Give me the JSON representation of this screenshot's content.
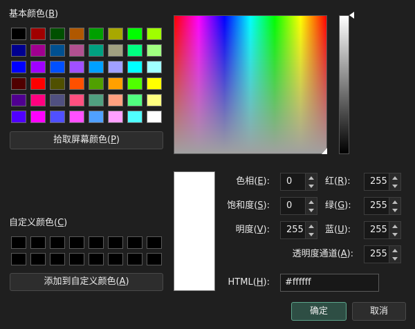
{
  "basic_colors": {
    "label": "基本颜色(",
    "label_key": "B",
    "label_tail": ")",
    "swatches": [
      "#000000",
      "#a00000",
      "#005000",
      "#b05800",
      "#00a000",
      "#a8a800",
      "#00ff00",
      "#a0ff00",
      "#000090",
      "#a00090",
      "#005090",
      "#b05090",
      "#00a080",
      "#a0a080",
      "#00ff80",
      "#a0ff80",
      "#0000ff",
      "#a000ff",
      "#0050ff",
      "#a050ff",
      "#00a0ff",
      "#a0a0ff",
      "#00ffff",
      "#a0ffff",
      "#500000",
      "#ff0000",
      "#505000",
      "#ff5000",
      "#50a000",
      "#ffa000",
      "#50ff00",
      "#ffff00",
      "#500090",
      "#ff0080",
      "#505080",
      "#ff5080",
      "#50a080",
      "#ffa080",
      "#50ff80",
      "#ffff80",
      "#5000ff",
      "#ff00ff",
      "#5050ff",
      "#ff50ff",
      "#50a0ff",
      "#ffa0ff",
      "#50ffff",
      "#ffffff"
    ]
  },
  "pick_screen_button": {
    "label": "拾取屏幕颜色(",
    "key": "P",
    "tail": ")"
  },
  "custom_colors": {
    "label": "自定义颜色(",
    "label_key": "C",
    "label_tail": ")",
    "count": 16
  },
  "add_custom_button": {
    "label": "添加到自定义颜色(",
    "key": "A",
    "tail": ")"
  },
  "fields": {
    "hue": {
      "label": "色相(",
      "key": "E",
      "tail": "):",
      "value": "0"
    },
    "sat": {
      "label": "饱和度(",
      "key": "S",
      "tail": "):",
      "value": "0"
    },
    "val": {
      "label": "明度(",
      "key": "V",
      "tail": "):",
      "value": "255"
    },
    "red": {
      "label": "红(",
      "key": "R",
      "tail": "):",
      "value": "255"
    },
    "green": {
      "label": "绿(",
      "key": "G",
      "tail": "):",
      "value": "255"
    },
    "blue": {
      "label": "蓝(",
      "key": "U",
      "tail": "):",
      "value": "255"
    },
    "alpha": {
      "label": "透明度通道(",
      "key": "A",
      "tail": "):",
      "value": "255"
    },
    "html": {
      "label": "HTML(",
      "key": "H",
      "tail": "):",
      "value": "#ffffff"
    }
  },
  "ok_button": "确定",
  "cancel_button": "取消",
  "current_color": "#ffffff"
}
